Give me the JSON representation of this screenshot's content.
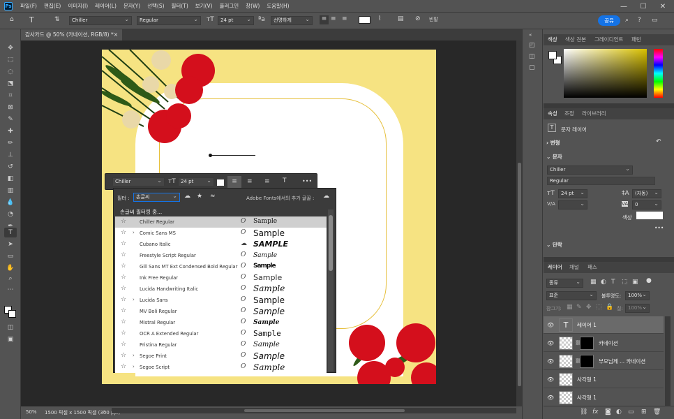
{
  "menubar": {
    "logo": "Ps",
    "items": [
      "파일(F)",
      "편집(E)",
      "이미지(I)",
      "레이어(L)",
      "문자(Y)",
      "선택(S)",
      "필터(T)",
      "보기(V)",
      "플러그인",
      "창(W)",
      "도움말(H)"
    ],
    "minimize": "—",
    "maximize": "☐",
    "close": "✕"
  },
  "options": {
    "font_family": "Chiller",
    "font_style": "Regular",
    "font_size": "24 pt",
    "antialias": "선명하게",
    "share_label": "공유"
  },
  "document": {
    "tab_title": "감사카드 @ 50% (카네이션, RGB/8) *",
    "close": "×"
  },
  "status": {
    "zoom": "50%",
    "info": "1500 픽셀 x 1500 픽셀 (300 ppi)"
  },
  "color_panel": {
    "tabs": [
      "색상",
      "색상 견본",
      "그레이디언트",
      "패턴"
    ]
  },
  "properties_panel": {
    "tabs": [
      "속성",
      "조정",
      "라이브러리"
    ],
    "layer_kind": "문자 레이어",
    "transform": "변형",
    "character": "문자",
    "font_family": "Chiller",
    "font_style": "Regular",
    "font_size": "24 pt",
    "leading": "(자동)",
    "tracking": "0",
    "color_label": "색상",
    "paragraph": "단락",
    "more": "•••"
  },
  "layers_panel": {
    "tabs": [
      "레이어",
      "채널",
      "패스"
    ],
    "filter_kind": "종류",
    "blend_mode": "표준",
    "opacity_label": "불투명도:",
    "opacity": "100%",
    "lock_label": "잠그기:",
    "fill_label": "칠:",
    "fill": "100%",
    "layers": [
      {
        "name": "레이어 1"
      },
      {
        "name": "카네이션"
      },
      {
        "name": "부모님께 ... 카네이션"
      },
      {
        "name": "사각형 1"
      },
      {
        "name": "사각형 1"
      }
    ]
  },
  "char_float": {
    "font": "Chiller",
    "size": "24 pt",
    "more": "•••"
  },
  "font_panel": {
    "filter_label": "필터 :",
    "filter_value": "손글씨",
    "adobe_fonts_label": "Adobe Fonts에서의 추가 글꼴 :",
    "filtering_status": "손글씨 필터링 중...",
    "fonts": [
      {
        "name": "Chiller Regular",
        "sample": "Sample",
        "expand": ""
      },
      {
        "name": "Comic Sans MS",
        "sample": "Sample",
        "expand": "›"
      },
      {
        "name": "Cubano Italic",
        "sample": "SAMPLE",
        "expand": ""
      },
      {
        "name": "Freestyle Script Regular",
        "sample": "Sample",
        "expand": ""
      },
      {
        "name": "Gill Sans MT Ext Condensed Bold Regular",
        "sample": "Sample",
        "expand": ""
      },
      {
        "name": "Ink Free Regular",
        "sample": "Sample",
        "expand": ""
      },
      {
        "name": "Lucida Handwriting Italic",
        "sample": "Sample",
        "expand": ""
      },
      {
        "name": "Lucida Sans",
        "sample": "Sample",
        "expand": "›"
      },
      {
        "name": "MV Boli Regular",
        "sample": "Sample",
        "expand": ""
      },
      {
        "name": "Mistral Regular",
        "sample": "Sample",
        "expand": ""
      },
      {
        "name": "OCR A Extended Regular",
        "sample": "Sample",
        "expand": ""
      },
      {
        "name": "Pristina Regular",
        "sample": "Sample",
        "expand": ""
      },
      {
        "name": "Segoe Print",
        "sample": "Sample",
        "expand": "›"
      },
      {
        "name": "Segoe Script",
        "sample": "Sample",
        "expand": "›"
      }
    ]
  }
}
